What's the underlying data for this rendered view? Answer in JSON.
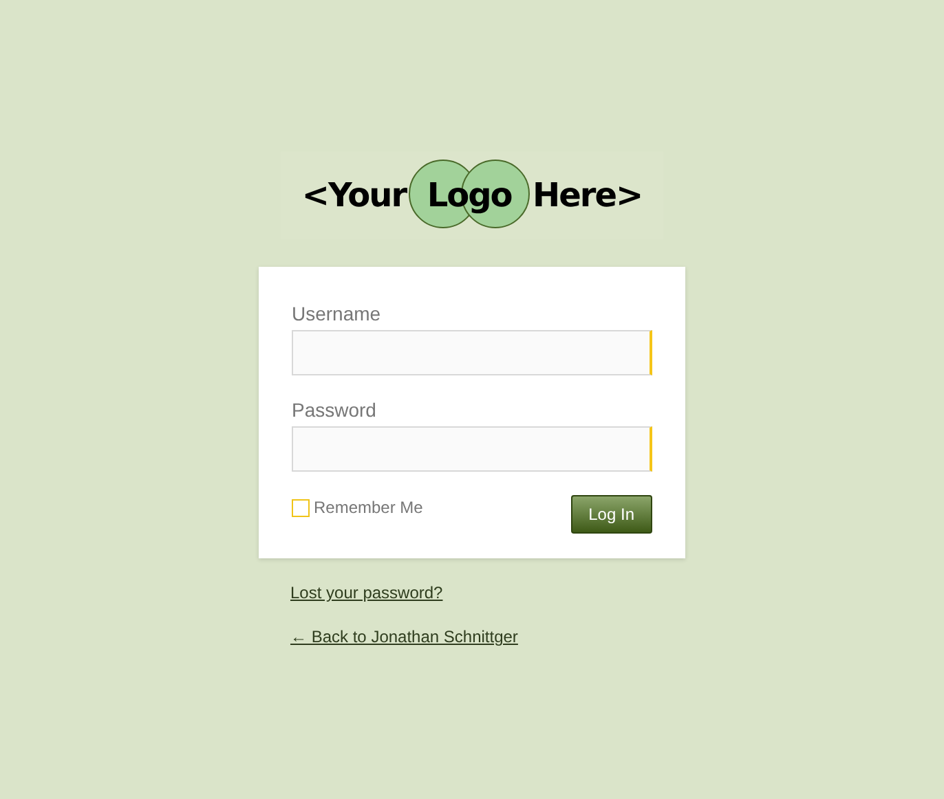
{
  "logo": {
    "words": [
      "<Your",
      "Logo",
      "Here>"
    ]
  },
  "form": {
    "fields": [
      {
        "label": "Username"
      },
      {
        "label": "Password"
      }
    ],
    "remember": {
      "label": "Remember Me",
      "checked": false
    },
    "submit": "Log In"
  },
  "links": [
    "Lost your password?",
    "← Back to Jonathan Schnittger"
  ]
}
